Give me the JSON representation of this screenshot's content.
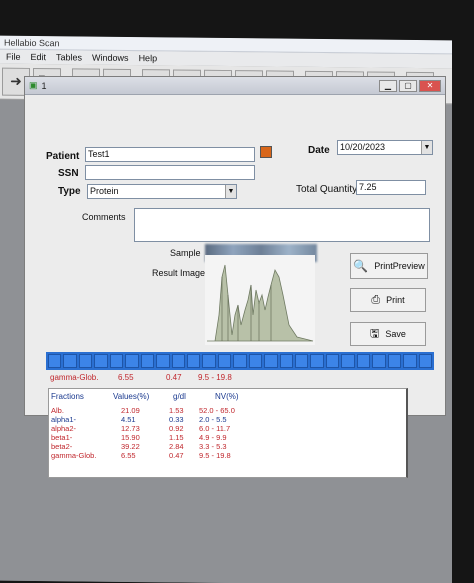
{
  "app_title": "Hellabio Scan",
  "menu": [
    "File",
    "Edit",
    "Tables",
    "Windows",
    "Help"
  ],
  "child_title": "1",
  "form": {
    "patient_label": "Patient",
    "patient_value": "Test1",
    "ssn_label": "SSN",
    "ssn_value": "",
    "type_label": "Type",
    "type_value": "Protein",
    "date_label": "Date",
    "date_value": "10/20/2023",
    "total_qty_label": "Total Quantity",
    "total_qty_value": "7.25",
    "comments_label": "Comments",
    "sample_label": "Sample",
    "result_image_label": "Result Image"
  },
  "buttons": {
    "print_preview": "PrintPreview",
    "print": "Print",
    "save": "Save"
  },
  "selected_row": {
    "name": "gamma-Glob.",
    "value": "6.55",
    "gdl": "0.47",
    "nv": "9.5 - 19.8"
  },
  "table": {
    "headers": {
      "fractions": "Fractions",
      "values": "Values(%)",
      "gdl": "g/dl",
      "nv": "NV(%)"
    },
    "rows": [
      {
        "name": "Alb.",
        "value": "21.09",
        "gdl": "1.53",
        "nv": "52.0 - 65.0",
        "color": "#c0272d"
      },
      {
        "name": "alpha1-",
        "value": "4.51",
        "gdl": "0.33",
        "nv": "2.0 - 5.5",
        "color": "#1b3a8f"
      },
      {
        "name": "alpha2-",
        "value": "12.73",
        "gdl": "0.92",
        "nv": "6.0 - 11.7",
        "color": "#c0272d"
      },
      {
        "name": "beta1-",
        "value": "15.90",
        "gdl": "1.15",
        "nv": "4.9 - 9.9",
        "color": "#c0272d"
      },
      {
        "name": "beta2-",
        "value": "39.22",
        "gdl": "2.84",
        "nv": "3.3 - 5.3",
        "color": "#c0272d"
      },
      {
        "name": "gamma-Glob.",
        "value": "6.55",
        "gdl": "0.47",
        "nv": "9.5 - 19.8",
        "color": "#c0272d"
      }
    ]
  },
  "colors": {
    "accent": "#2a6fd1",
    "abnormal": "#c0272d",
    "normal": "#1b3a8f"
  }
}
